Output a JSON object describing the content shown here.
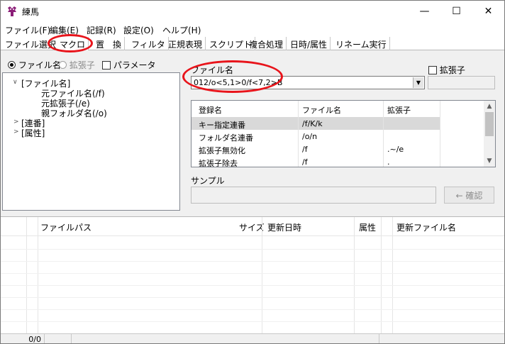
{
  "window": {
    "title": "練馬",
    "minimize": "—",
    "maximize": "☐",
    "close": "✕"
  },
  "menu": [
    {
      "label": "ファイル(F)"
    },
    {
      "label": "編集(E)"
    },
    {
      "label": "記録(R)"
    },
    {
      "label": "設定(O)"
    },
    {
      "label": "ヘルプ(H)"
    }
  ],
  "tabs": [
    {
      "label": "ファイル選択"
    },
    {
      "label": "マクロ"
    },
    {
      "label": "置　換"
    },
    {
      "label": "フィルタ"
    },
    {
      "label": "正規表現"
    },
    {
      "label": "スクリプト"
    },
    {
      "label": "複合処理"
    },
    {
      "label": "日時/属性"
    },
    {
      "label": "リネーム実行"
    }
  ],
  "options": {
    "filename": "ファイル名",
    "extension": "拡張子",
    "parameter": "パラメータ"
  },
  "tree": {
    "filename_group": "[ファイル名]",
    "children": [
      "元ファイル名(/f)",
      "元拡張子(/e)",
      "親フォルダ名(/o)"
    ],
    "serial": "[連番]",
    "attribute": "[属性]"
  },
  "macro": {
    "filename_label": "ファイル名",
    "filename_value": "012/o<5,1>0/f<7,2>B",
    "extension_checkbox": "拡張子"
  },
  "macro_table": {
    "headers": [
      "登録名",
      "ファイル名",
      "拡張子"
    ],
    "rows": [
      {
        "name": "キー指定連番",
        "filename": "/f/K/k",
        "ext": ""
      },
      {
        "name": "フォルダ名連番",
        "filename": "/o/n",
        "ext": ""
      },
      {
        "name": "拡張子無効化",
        "filename": "/f",
        "ext": ".~/e"
      },
      {
        "name": "拡張子除去",
        "filename": "/f",
        "ext": "."
      }
    ]
  },
  "sample": {
    "label": "サンプル",
    "confirm": "← 確認"
  },
  "filelist": {
    "headers": [
      "ファイルパス",
      "サイズ",
      "更新日時",
      "属性",
      "更新ファイル名"
    ]
  },
  "status": {
    "count": "0/0"
  },
  "colors": {
    "highlight_ring": "#e8141b",
    "selected_row": "#d9d9d9",
    "app_icon": "#8b1e78"
  }
}
